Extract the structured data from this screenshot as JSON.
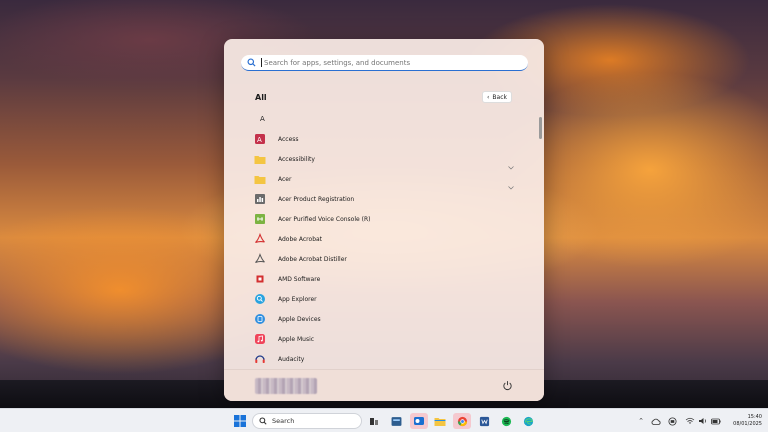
{
  "start_menu": {
    "search_placeholder": "Search for apps, settings, and documents",
    "section_title": "All",
    "back_label": "Back",
    "letter_group": "A",
    "apps": [
      {
        "label": "Access",
        "icon": "access-icon",
        "color": "#c4314b",
        "expandable": false
      },
      {
        "label": "Accessibility",
        "icon": "folder-icon",
        "color": "#f4c542",
        "expandable": true
      },
      {
        "label": "Acer",
        "icon": "folder-icon",
        "color": "#f4c542",
        "expandable": true
      },
      {
        "label": "Acer Product Registration",
        "icon": "acer-registration-icon",
        "color": "#6b6b6b",
        "expandable": false
      },
      {
        "label": "Acer Purified Voice Console (R)",
        "icon": "acer-voice-icon",
        "color": "#7cb342",
        "expandable": false
      },
      {
        "label": "Adobe Acrobat",
        "icon": "acrobat-icon",
        "color": "#d32f2f",
        "expandable": false
      },
      {
        "label": "Adobe Acrobat Distiller",
        "icon": "acrobat-distiller-icon",
        "color": "#555555",
        "expandable": false
      },
      {
        "label": "AMD Software",
        "icon": "amd-icon",
        "color": "#d32f2f",
        "expandable": false
      },
      {
        "label": "App Explorer",
        "icon": "app-explorer-icon",
        "color": "#29a3e0",
        "expandable": false
      },
      {
        "label": "Apple Devices",
        "icon": "apple-devices-icon",
        "color": "#2f8fe0",
        "expandable": false
      },
      {
        "label": "Apple Music",
        "icon": "apple-music-icon",
        "color": "#f0445a",
        "expandable": false
      },
      {
        "label": "Audacity",
        "icon": "audacity-icon",
        "color": "#1e3a8a",
        "expandable": false
      }
    ]
  },
  "taskbar": {
    "search_label": "Search",
    "time": "15:40",
    "date": "08/01/2025"
  }
}
